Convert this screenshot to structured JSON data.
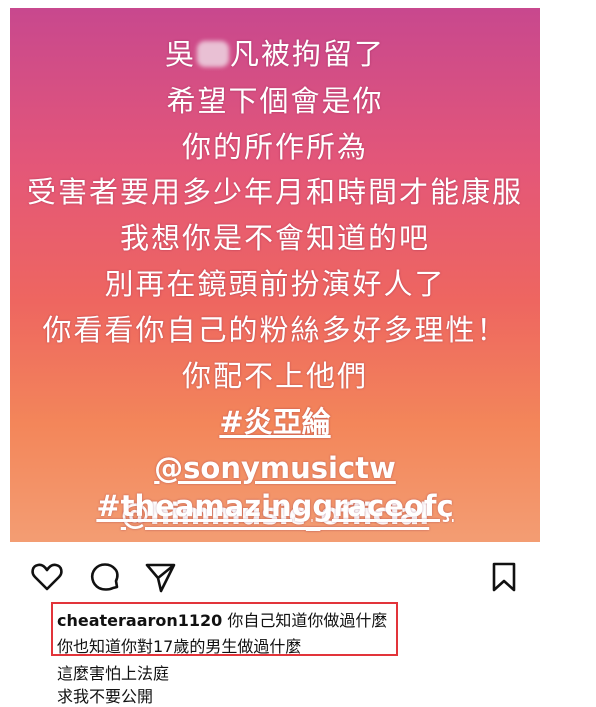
{
  "story": {
    "line1_before": "吳",
    "line1_after": "凡被拘留了",
    "lines": [
      "希望下個會是你",
      "你的所作所為",
      "受害者要用多少年月和時間才能康服",
      "我想你是不會知道的吧",
      "別再在鏡頭前扮演好人了",
      "你看看你自己的粉絲多好多理性！",
      "你配不上他們"
    ],
    "tags": [
      "#炎亞綸",
      "@sonymusictw",
      "@himmusic_official",
      "#theamazinggraceofç"
    ]
  },
  "actions": {
    "like_icon": "heart-icon",
    "comment_icon": "comment-icon",
    "share_icon": "send-icon",
    "save_icon": "bookmark-icon"
  },
  "caption": {
    "username": "cheateraaron1120",
    "text1": "你自己知道你做過什麼",
    "text2": "你也知道你對17歲的男生做過什麼",
    "text3": "這麼害怕上法庭",
    "text4": "求我不要公開"
  },
  "colors": {
    "highlight_border": "#e2343a"
  }
}
